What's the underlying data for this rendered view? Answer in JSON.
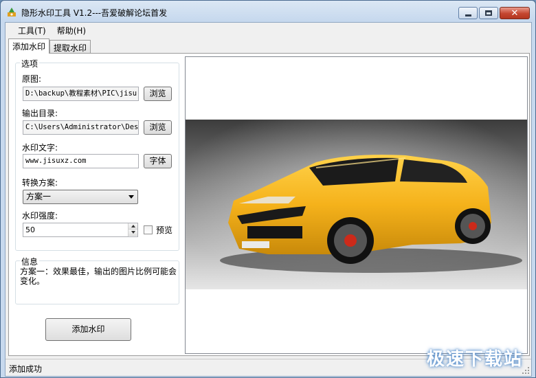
{
  "window": {
    "title": "隐形水印工具 V1.2---吾爱破解论坛首发"
  },
  "menu": {
    "items": [
      "工具(T)",
      "帮助(H)"
    ]
  },
  "tabs": [
    {
      "label": "添加水印",
      "active": true
    },
    {
      "label": "提取水印",
      "active": false
    }
  ],
  "options": {
    "group_title": "选项",
    "source_label": "原图:",
    "source_value": "D:\\backup\\教程素材\\PIC\\jisu",
    "browse1_label": "浏览",
    "output_label": "输出目录:",
    "output_value": "C:\\Users\\Administrator\\Desk",
    "browse2_label": "浏览",
    "text_label": "水印文字:",
    "text_value": "www.jisuxz.com",
    "font_button": "字体",
    "scheme_label": "转换方案:",
    "scheme_value": "方案一",
    "strength_label": "水印强度:",
    "strength_value": "50",
    "preview_label": "预览"
  },
  "info": {
    "group_title": "信息",
    "text": "方案一：效果最佳，输出的图片比例可能会变化。"
  },
  "add_button": "添加水印",
  "status": {
    "text": "添加成功"
  },
  "watermark": "极速下载站",
  "colors": {
    "car_yellow": "#f5b21b",
    "title_bg": "#c7d9ee",
    "close_red": "#c4462f"
  }
}
